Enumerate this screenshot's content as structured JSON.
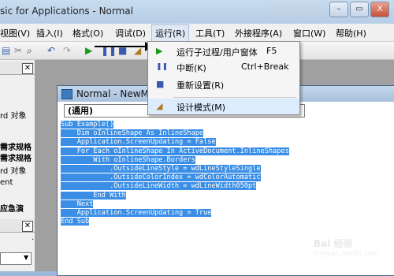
{
  "window": {
    "title": "sic for Applications - Normal",
    "minimize": "–",
    "close": "X"
  },
  "menubar": {
    "items": [
      {
        "label": "视图(V)"
      },
      {
        "label": "插入(I)"
      },
      {
        "label": "格式(O)"
      },
      {
        "label": "调试(D)"
      },
      {
        "label": "运行(R)"
      },
      {
        "label": "工具(T)"
      },
      {
        "label": "外接程序(A)"
      },
      {
        "label": "窗口(W)"
      },
      {
        "label": "帮助(H)"
      }
    ]
  },
  "run_menu": {
    "items": [
      {
        "label": "运行子过程/用户窗体",
        "shortcut": "F5",
        "icon": "play-icon"
      },
      {
        "label": "中断(K)",
        "shortcut": "Ctrl+Break",
        "icon": "pause-icon"
      },
      {
        "label": "重新设置(R)",
        "shortcut": "",
        "icon": "stop-icon"
      },
      {
        "label": "设计模式(M)",
        "shortcut": "",
        "icon": "design-mode-icon"
      }
    ]
  },
  "left_pane": {
    "texts": [
      "rd 对象",
      "需求规格",
      "需求规格",
      "rd 对象",
      "ent",
      "应急演",
      "."
    ]
  },
  "code_window": {
    "title": "Normal - NewMa",
    "combo_value": "(通用)",
    "lines": [
      "Sub Example()",
      "    Dim oInlineShape As InlineShape",
      "    Application.ScreenUpdating = False",
      "    For Each oInlineShape In ActiveDocument.InlineShapes",
      "        With oInlineShape.Borders",
      "            .OutsideLineStyle = wdLineStyleSingle",
      "            .OutsideColorIndex = wdColorAutomatic",
      "            .OutsideLineWidth = wdLineWidth050pt",
      "        End With",
      "    Next",
      "    Application.ScreenUpdating = True",
      "End Sub"
    ]
  },
  "watermark": {
    "main": "Bai 经验",
    "sub": "jingyan.baidu.com"
  },
  "colors": {
    "selection": "#3a8ee6",
    "titlebar": "#b5cde6",
    "menu_highlight": "#dcecfc"
  }
}
